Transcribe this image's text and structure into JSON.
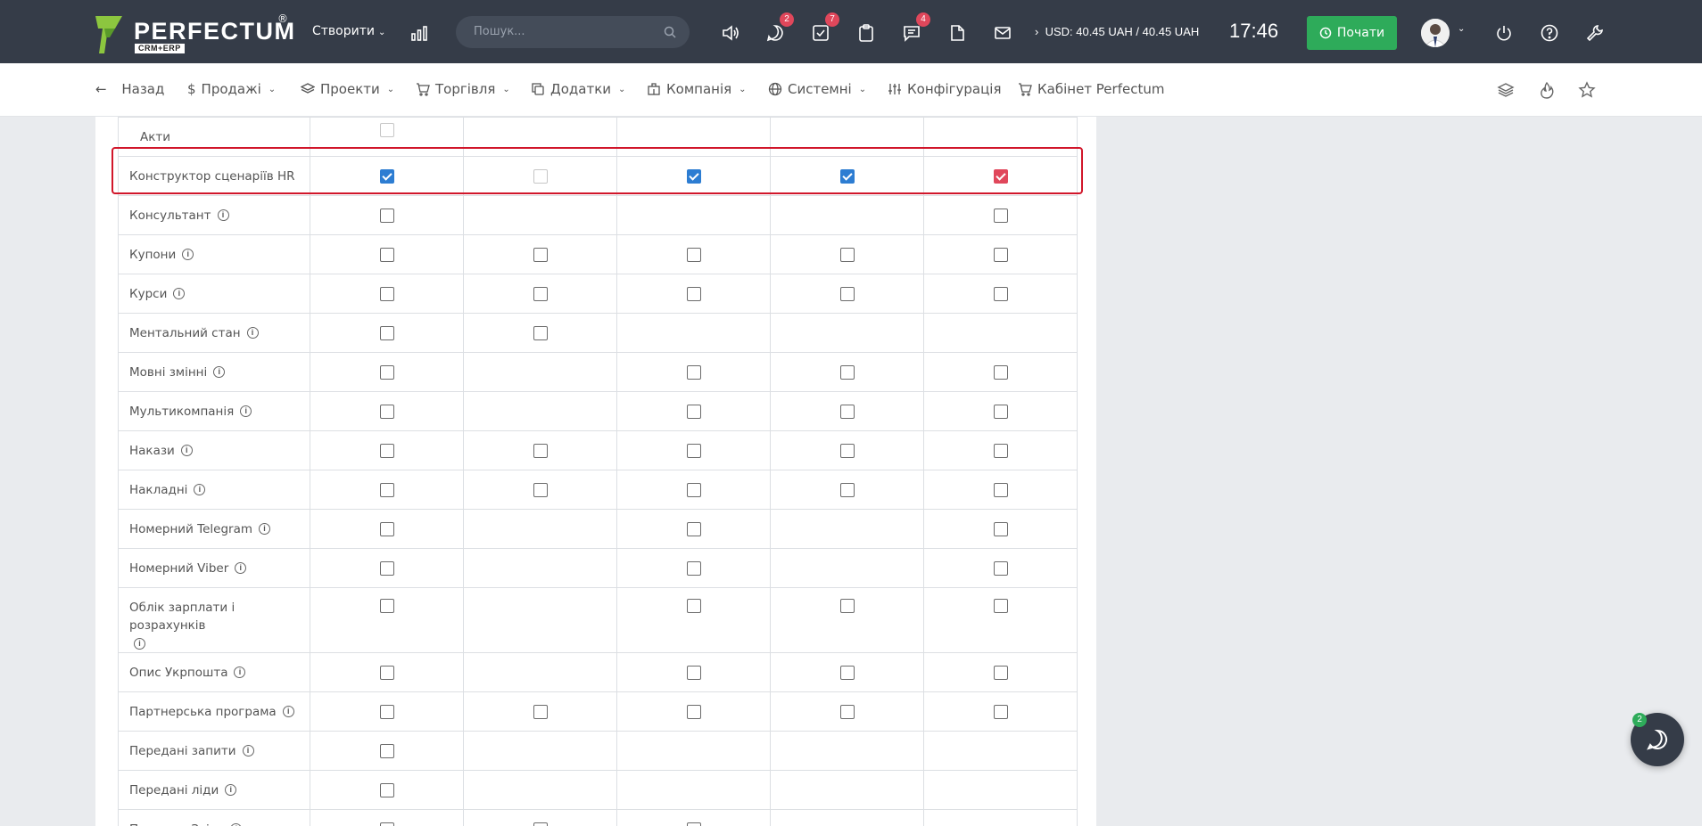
{
  "topbar": {
    "logo_text": "PERFECTUM",
    "logo_reg": "®",
    "logo_sub": "CRM+ERP",
    "create_label": "Створити",
    "search_placeholder": "Пошук...",
    "badges": {
      "chat": "2",
      "tasks": "7",
      "messages": "4"
    },
    "currency": "USD: 40.45 UAH / 40.45 UAH",
    "time": "17:46",
    "start_label": "Почати",
    "icons": [
      "stats-icon",
      "speaker-icon",
      "chat-icon",
      "tasks-icon",
      "clipboard-icon",
      "messages-icon",
      "document-icon",
      "mail-icon",
      "power-icon",
      "help-icon",
      "wrench-icon"
    ]
  },
  "subnav": {
    "back": "Назад",
    "sales": "Продажі",
    "projects": "Проекти",
    "trade": "Торгівля",
    "addons": "Додатки",
    "company": "Компанія",
    "system": "Системні",
    "config": "Конфігурація",
    "cabinet": "Кабінет Perfectum"
  },
  "table": {
    "rows": [
      {
        "name": "Акти",
        "info": false,
        "cells": [
          "disabled",
          "none",
          "none",
          "none",
          "none"
        ]
      },
      {
        "name": "Конструктор сценаріїв HR",
        "info": false,
        "cells": [
          "checked",
          "disabled",
          "checked",
          "checked",
          "red"
        ]
      },
      {
        "name": "Консультант",
        "info": true,
        "cells": [
          "empty",
          "none",
          "none",
          "none",
          "empty"
        ]
      },
      {
        "name": "Купони",
        "info": true,
        "cells": [
          "empty",
          "empty",
          "empty",
          "empty",
          "empty"
        ]
      },
      {
        "name": "Курси",
        "info": true,
        "cells": [
          "empty",
          "empty",
          "empty",
          "empty",
          "empty"
        ]
      },
      {
        "name": "Ментальний стан",
        "info": true,
        "cells": [
          "empty",
          "empty",
          "none",
          "none",
          "none"
        ]
      },
      {
        "name": "Мовні змінні",
        "info": true,
        "cells": [
          "empty",
          "none",
          "empty",
          "empty",
          "empty"
        ]
      },
      {
        "name": "Мультикомпанія",
        "info": true,
        "cells": [
          "empty",
          "none",
          "empty",
          "empty",
          "empty"
        ]
      },
      {
        "name": "Накази",
        "info": true,
        "cells": [
          "empty",
          "empty",
          "empty",
          "empty",
          "empty"
        ]
      },
      {
        "name": "Накладні",
        "info": true,
        "cells": [
          "empty",
          "empty",
          "empty",
          "empty",
          "empty"
        ]
      },
      {
        "name": "Номерний Telegram",
        "info": true,
        "cells": [
          "empty",
          "none",
          "empty",
          "none",
          "empty"
        ]
      },
      {
        "name": "Номерний Viber",
        "info": true,
        "cells": [
          "empty",
          "none",
          "empty",
          "none",
          "empty"
        ]
      },
      {
        "name": "Облік зарплати і розрахунків",
        "info": true,
        "tall": true,
        "cells": [
          "empty",
          "none",
          "empty",
          "empty",
          "empty"
        ]
      },
      {
        "name": "Опис Укрпошта",
        "info": true,
        "cells": [
          "empty",
          "none",
          "empty",
          "empty",
          "empty"
        ]
      },
      {
        "name": "Партнерська програма",
        "info": true,
        "cells": [
          "empty",
          "empty",
          "empty",
          "empty",
          "empty"
        ]
      },
      {
        "name": "Передані запити",
        "info": true,
        "cells": [
          "empty",
          "none",
          "none",
          "none",
          "none"
        ]
      },
      {
        "name": "Передані ліди",
        "info": true,
        "cells": [
          "empty",
          "none",
          "none",
          "none",
          "none"
        ]
      },
      {
        "name": "Плани та Звіти",
        "info": true,
        "cells": [
          "empty",
          "empty",
          "empty",
          "none",
          "none"
        ]
      }
    ]
  },
  "chat_widget": {
    "badge": "2"
  },
  "colors": {
    "topbar": "#353c48",
    "accent_blue": "#2d7dd2",
    "accent_red": "#e0475b",
    "green": "#2eab5a",
    "highlight": "#d1162a"
  }
}
